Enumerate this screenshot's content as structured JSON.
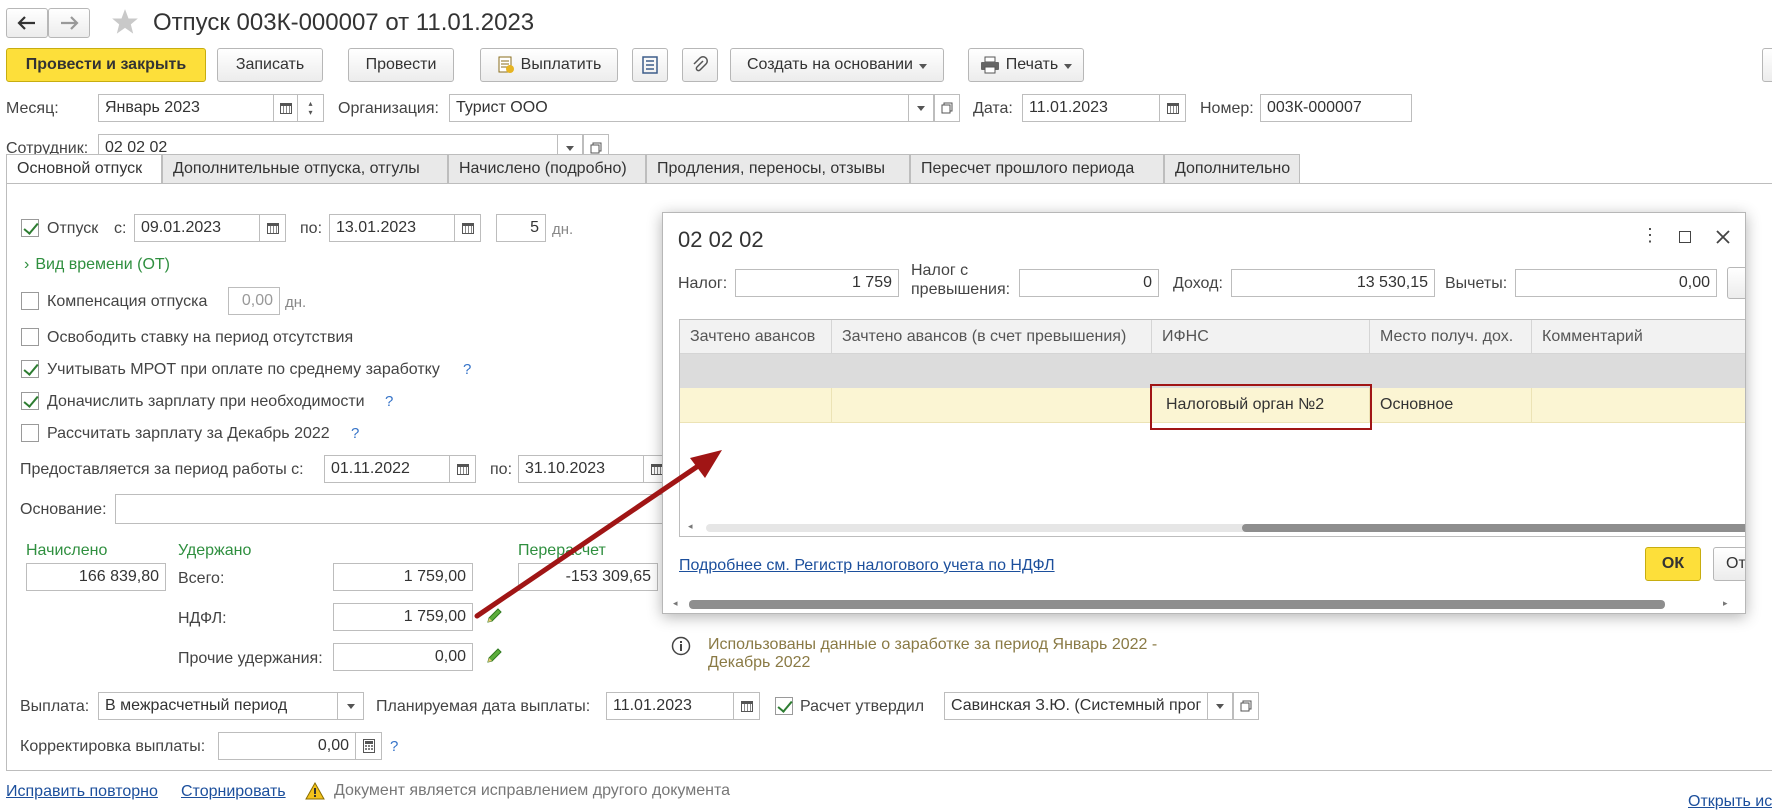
{
  "window": {
    "title": "Отпуск 003К-000007 от 11.01.2023",
    "open_link": "Открыть ис"
  },
  "toolbar": {
    "post_close": "Провести и закрыть",
    "save": "Записать",
    "post": "Провести",
    "pay": "Выплатить",
    "create_based": "Создать на основании",
    "print": "Печать"
  },
  "header": {
    "month_label": "Месяц:",
    "month_value": "Январь 2023",
    "org_label": "Организация:",
    "org_value": "Турист ООО",
    "date_label": "Дата:",
    "date_value": "11.01.2023",
    "number_label": "Номер:",
    "number_value": "003К-000007",
    "employee_label": "Сотрудник:",
    "employee_value": "02 02 02"
  },
  "tabs": [
    {
      "label": "Основной отпуск"
    },
    {
      "label": "Дополнительные отпуска, отгулы"
    },
    {
      "label": "Начислено (подробно)"
    },
    {
      "label": "Продления, переносы, отзывы"
    },
    {
      "label": "Пересчет прошлого периода"
    },
    {
      "label": "Дополнительно"
    }
  ],
  "main": {
    "vacation_label": "Отпуск",
    "from_label": "с:",
    "from_value": "09.01.2023",
    "to_label": "по:",
    "to_value": "13.01.2023",
    "days_value": "5",
    "days_unit": "дн.",
    "time_kind": "Вид времени (ОТ)",
    "compensation_label": "Компенсация отпуска",
    "compensation_value": "0,00",
    "compensation_unit": "дн.",
    "release_rate": "Освободить ставку на период отсутствия",
    "consider_mrot": "Учитывать МРОТ при оплате по среднему заработку",
    "accrue_salary": "Доначислить зарплату при необходимости",
    "calc_salary": "Рассчитать зарплату за Декабрь 2022",
    "help": "?",
    "period_label": "Предоставляется за период работы с:",
    "period_from": "01.11.2022",
    "period_to_label": "по:",
    "period_to": "31.10.2023",
    "basis_label": "Основание:",
    "accrued_label": "Начислено",
    "accrued_value": "166 839,80",
    "withheld_label": "Удержано",
    "total_label": "Всего:",
    "total_value": "1 759,00",
    "ndfl_label": "НДФЛ:",
    "ndfl_value": "1 759,00",
    "other_label": "Прочие удержания:",
    "other_value": "0,00",
    "recalc_label": "Перерасчет",
    "recalc_value": "-153 309,65",
    "info_text_1": "Использованы данные о заработке за период Январь 2022 -",
    "info_text_2": "Декабрь 2022",
    "payout_label": "Выплата:",
    "payout_value": "В межрасчетный период",
    "planned_date_label": "Планируемая дата выплаты:",
    "planned_date_value": "11.01.2023",
    "approved_label": "Расчет утвердил",
    "approved_value": "Савинская З.Ю. (Системный прог",
    "adjust_label": "Корректировка выплаты:",
    "adjust_value": "0,00"
  },
  "footer": {
    "fix_again": "Исправить повторно",
    "reverse": "Сторнировать",
    "warning": "Документ является исправлением другого документа"
  },
  "dialog": {
    "title": "02 02 02",
    "tax_label": "Налог:",
    "tax_value": "1 759",
    "tax_excess_label_1": "Налог с",
    "tax_excess_label_2": "превышения:",
    "tax_excess_value": "0",
    "income_label": "Доход:",
    "income_value": "13 530,15",
    "deductions_label": "Вычеты:",
    "deductions_value": "0,00",
    "columns": [
      "Зачтено авансов",
      "Зачтено авансов (в счет превышения)",
      "ИФНС",
      "Место получ. дох.",
      "Комментарий"
    ],
    "row": {
      "ifns": "Налоговый орган №2",
      "place": "Основное"
    },
    "details_link": "Подробнее см. Регистр налогового учета по НДФЛ",
    "ok": "ОК",
    "cancel": "От"
  },
  "colors": {
    "primary_button": "#fddf3a",
    "highlight_row": "#fbf5d3",
    "annotation": "#a01515",
    "green_label": "#2f8f3f"
  }
}
